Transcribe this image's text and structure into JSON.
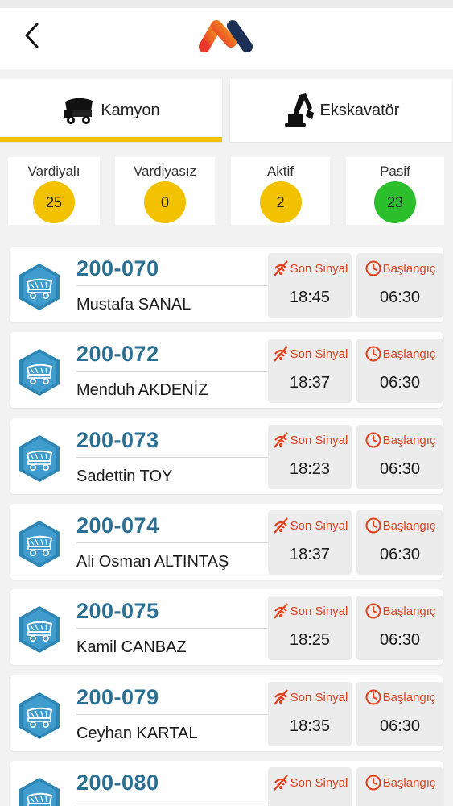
{
  "tabs": [
    {
      "label": "Kamyon",
      "active": true
    },
    {
      "label": "Ekskavatör",
      "active": false
    }
  ],
  "stats": [
    {
      "label": "Vardiyalı",
      "value": "25",
      "color": "#f2c200"
    },
    {
      "label": "Vardiyasız",
      "value": "0",
      "color": "#f2c200"
    },
    {
      "label": "Aktif",
      "value": "2",
      "color": "#f2c200"
    },
    {
      "label": "Pasif",
      "value": "23",
      "color": "#2bbf2b"
    }
  ],
  "signal_label": "Son Sinyal",
  "start_label": "Başlangıç",
  "vehicles": [
    {
      "code": "200-070",
      "driver": "Mustafa SANAL",
      "last_signal": "18:45",
      "start": "06:30"
    },
    {
      "code": "200-072",
      "driver": "Menduh AKDENİZ",
      "last_signal": "18:37",
      "start": "06:30"
    },
    {
      "code": "200-073",
      "driver": "Sadettin TOY",
      "last_signal": "18:23",
      "start": "06:30"
    },
    {
      "code": "200-074",
      "driver": "Ali Osman ALTINTAŞ",
      "last_signal": "18:37",
      "start": "06:30"
    },
    {
      "code": "200-075",
      "driver": "Kamil CANBAZ",
      "last_signal": "18:25",
      "start": "06:30"
    },
    {
      "code": "200-079",
      "driver": "Ceyhan KARTAL",
      "last_signal": "18:35",
      "start": "06:30"
    },
    {
      "code": "200-080",
      "driver": "",
      "last_signal": "",
      "start": ""
    }
  ],
  "icons": {
    "back": "chevron-left-icon",
    "logo": "brand-logo",
    "truck": "dump-truck-icon",
    "excavator": "excavator-icon",
    "signal_off": "signal-off-icon",
    "clock": "clock-icon"
  },
  "colors": {
    "accent": "#f2c200",
    "code": "#2b6f93",
    "alert": "#e0401c",
    "hex_icon": "#2e86b5",
    "pasif": "#2bbf2b"
  }
}
